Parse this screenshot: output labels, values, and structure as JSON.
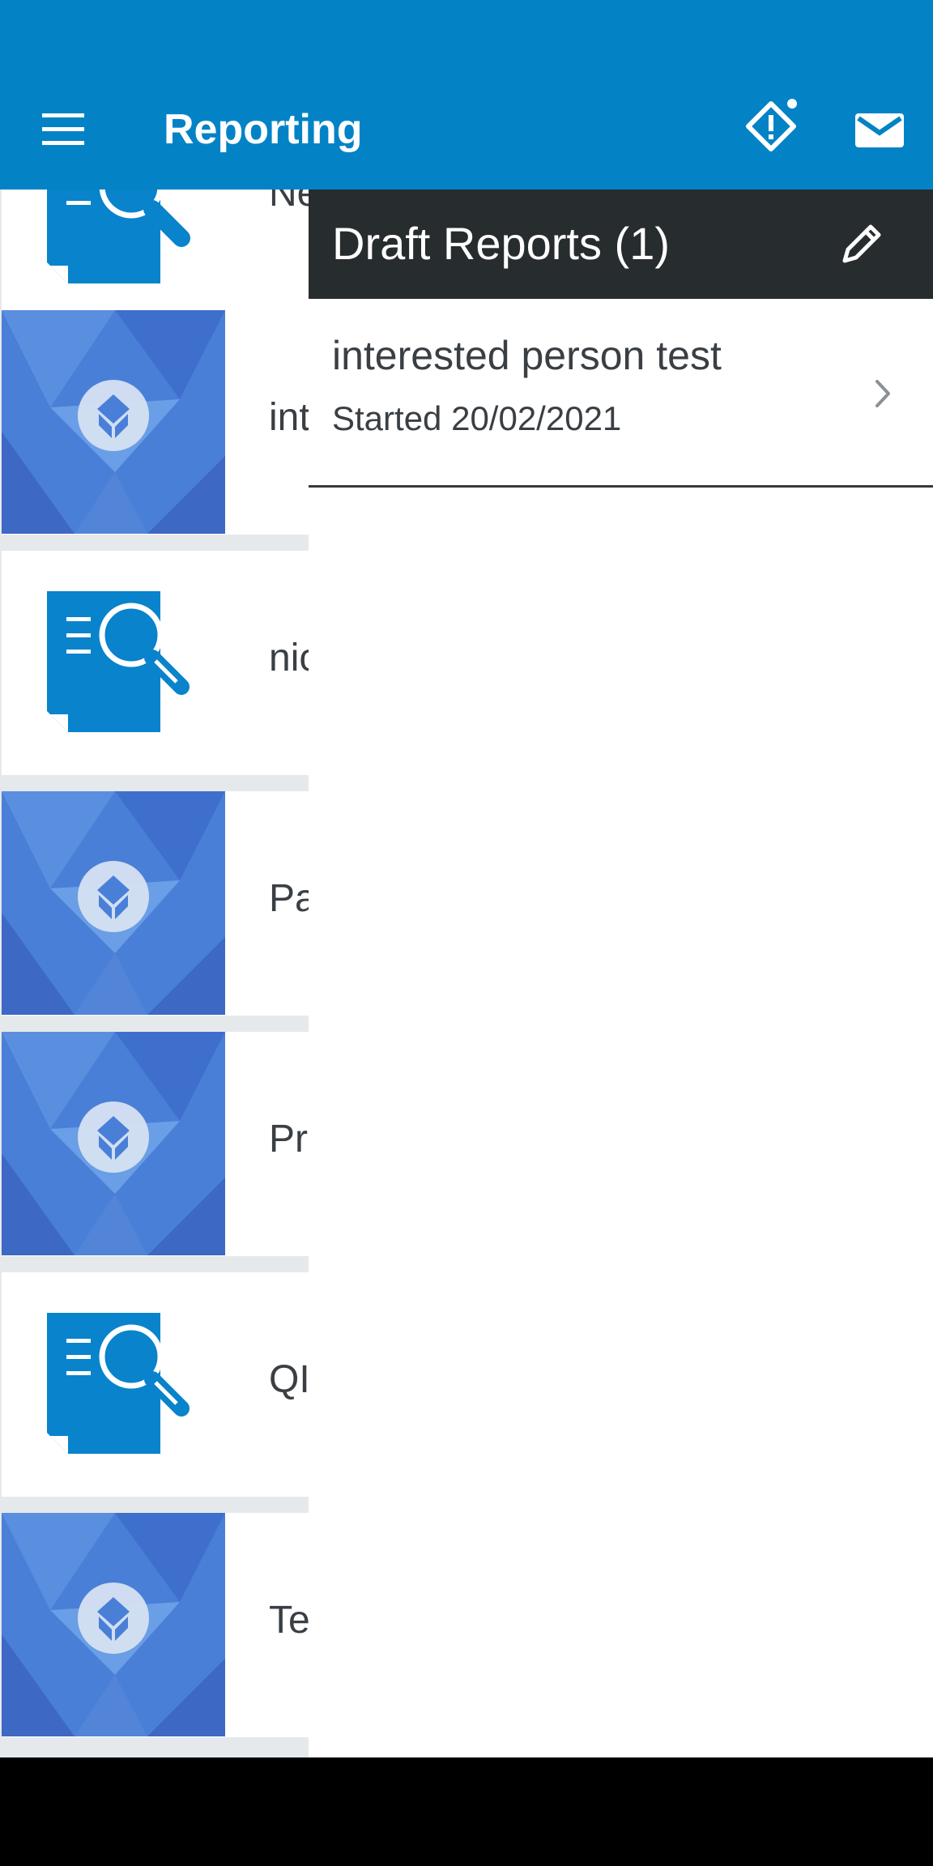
{
  "app_bar": {
    "title": "Reporting",
    "icons": [
      "menu-icon",
      "alert-diamond-icon",
      "mail-icon"
    ],
    "color": "#0383c6"
  },
  "background_list": {
    "rows": [
      {
        "text": "Ne",
        "thumb": "report-search-icon"
      },
      {
        "text": "int",
        "thumb": "polygon-image"
      },
      {
        "text": "nic",
        "thumb": "report-search-icon"
      },
      {
        "text": "Pa",
        "thumb": "polygon-image"
      },
      {
        "text": "Pr",
        "thumb": "polygon-image"
      },
      {
        "text": "QI",
        "thumb": "report-search-icon"
      },
      {
        "text": "Te",
        "thumb": "polygon-image"
      }
    ]
  },
  "draft_panel": {
    "title": "Draft Reports (1)",
    "header_color": "#272c2f",
    "items": [
      {
        "name": "interested person test",
        "date": "Started 20/02/2021"
      }
    ]
  }
}
